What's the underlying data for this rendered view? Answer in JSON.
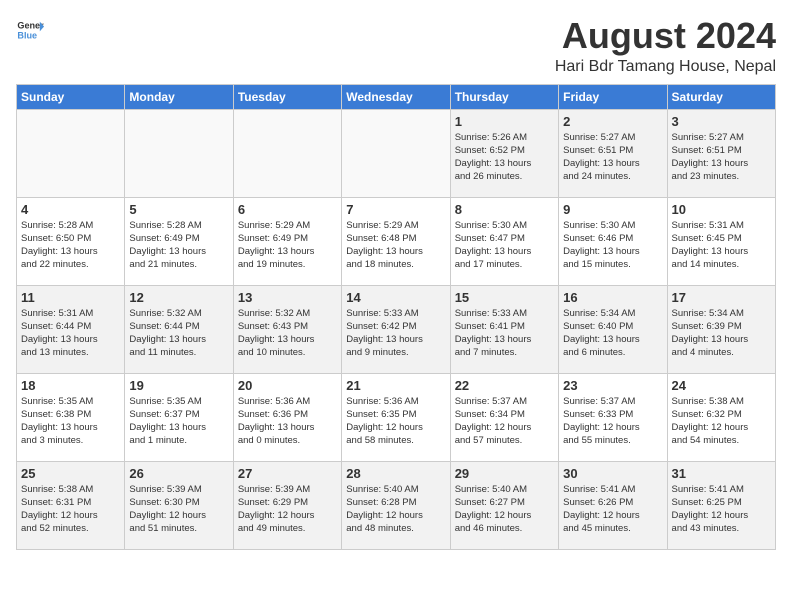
{
  "header": {
    "logo_general": "General",
    "logo_blue": "Blue",
    "month_year": "August 2024",
    "location": "Hari Bdr Tamang House, Nepal"
  },
  "weekdays": [
    "Sunday",
    "Monday",
    "Tuesday",
    "Wednesday",
    "Thursday",
    "Friday",
    "Saturday"
  ],
  "weeks": [
    [
      {
        "day": "",
        "info": ""
      },
      {
        "day": "",
        "info": ""
      },
      {
        "day": "",
        "info": ""
      },
      {
        "day": "",
        "info": ""
      },
      {
        "day": "1",
        "info": "Sunrise: 5:26 AM\nSunset: 6:52 PM\nDaylight: 13 hours\nand 26 minutes."
      },
      {
        "day": "2",
        "info": "Sunrise: 5:27 AM\nSunset: 6:51 PM\nDaylight: 13 hours\nand 24 minutes."
      },
      {
        "day": "3",
        "info": "Sunrise: 5:27 AM\nSunset: 6:51 PM\nDaylight: 13 hours\nand 23 minutes."
      }
    ],
    [
      {
        "day": "4",
        "info": "Sunrise: 5:28 AM\nSunset: 6:50 PM\nDaylight: 13 hours\nand 22 minutes."
      },
      {
        "day": "5",
        "info": "Sunrise: 5:28 AM\nSunset: 6:49 PM\nDaylight: 13 hours\nand 21 minutes."
      },
      {
        "day": "6",
        "info": "Sunrise: 5:29 AM\nSunset: 6:49 PM\nDaylight: 13 hours\nand 19 minutes."
      },
      {
        "day": "7",
        "info": "Sunrise: 5:29 AM\nSunset: 6:48 PM\nDaylight: 13 hours\nand 18 minutes."
      },
      {
        "day": "8",
        "info": "Sunrise: 5:30 AM\nSunset: 6:47 PM\nDaylight: 13 hours\nand 17 minutes."
      },
      {
        "day": "9",
        "info": "Sunrise: 5:30 AM\nSunset: 6:46 PM\nDaylight: 13 hours\nand 15 minutes."
      },
      {
        "day": "10",
        "info": "Sunrise: 5:31 AM\nSunset: 6:45 PM\nDaylight: 13 hours\nand 14 minutes."
      }
    ],
    [
      {
        "day": "11",
        "info": "Sunrise: 5:31 AM\nSunset: 6:44 PM\nDaylight: 13 hours\nand 13 minutes."
      },
      {
        "day": "12",
        "info": "Sunrise: 5:32 AM\nSunset: 6:44 PM\nDaylight: 13 hours\nand 11 minutes."
      },
      {
        "day": "13",
        "info": "Sunrise: 5:32 AM\nSunset: 6:43 PM\nDaylight: 13 hours\nand 10 minutes."
      },
      {
        "day": "14",
        "info": "Sunrise: 5:33 AM\nSunset: 6:42 PM\nDaylight: 13 hours\nand 9 minutes."
      },
      {
        "day": "15",
        "info": "Sunrise: 5:33 AM\nSunset: 6:41 PM\nDaylight: 13 hours\nand 7 minutes."
      },
      {
        "day": "16",
        "info": "Sunrise: 5:34 AM\nSunset: 6:40 PM\nDaylight: 13 hours\nand 6 minutes."
      },
      {
        "day": "17",
        "info": "Sunrise: 5:34 AM\nSunset: 6:39 PM\nDaylight: 13 hours\nand 4 minutes."
      }
    ],
    [
      {
        "day": "18",
        "info": "Sunrise: 5:35 AM\nSunset: 6:38 PM\nDaylight: 13 hours\nand 3 minutes."
      },
      {
        "day": "19",
        "info": "Sunrise: 5:35 AM\nSunset: 6:37 PM\nDaylight: 13 hours\nand 1 minute."
      },
      {
        "day": "20",
        "info": "Sunrise: 5:36 AM\nSunset: 6:36 PM\nDaylight: 13 hours\nand 0 minutes."
      },
      {
        "day": "21",
        "info": "Sunrise: 5:36 AM\nSunset: 6:35 PM\nDaylight: 12 hours\nand 58 minutes."
      },
      {
        "day": "22",
        "info": "Sunrise: 5:37 AM\nSunset: 6:34 PM\nDaylight: 12 hours\nand 57 minutes."
      },
      {
        "day": "23",
        "info": "Sunrise: 5:37 AM\nSunset: 6:33 PM\nDaylight: 12 hours\nand 55 minutes."
      },
      {
        "day": "24",
        "info": "Sunrise: 5:38 AM\nSunset: 6:32 PM\nDaylight: 12 hours\nand 54 minutes."
      }
    ],
    [
      {
        "day": "25",
        "info": "Sunrise: 5:38 AM\nSunset: 6:31 PM\nDaylight: 12 hours\nand 52 minutes."
      },
      {
        "day": "26",
        "info": "Sunrise: 5:39 AM\nSunset: 6:30 PM\nDaylight: 12 hours\nand 51 minutes."
      },
      {
        "day": "27",
        "info": "Sunrise: 5:39 AM\nSunset: 6:29 PM\nDaylight: 12 hours\nand 49 minutes."
      },
      {
        "day": "28",
        "info": "Sunrise: 5:40 AM\nSunset: 6:28 PM\nDaylight: 12 hours\nand 48 minutes."
      },
      {
        "day": "29",
        "info": "Sunrise: 5:40 AM\nSunset: 6:27 PM\nDaylight: 12 hours\nand 46 minutes."
      },
      {
        "day": "30",
        "info": "Sunrise: 5:41 AM\nSunset: 6:26 PM\nDaylight: 12 hours\nand 45 minutes."
      },
      {
        "day": "31",
        "info": "Sunrise: 5:41 AM\nSunset: 6:25 PM\nDaylight: 12 hours\nand 43 minutes."
      }
    ]
  ]
}
